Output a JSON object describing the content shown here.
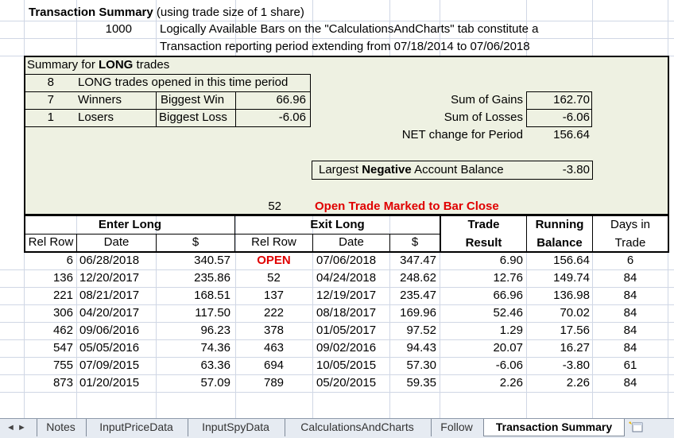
{
  "header": {
    "title_bold": "Transaction Summary",
    "title_rest": " (using trade size of 1 share)",
    "bars_count": "1000",
    "line1": "Logically Available Bars on the \"CalculationsAndCharts\" tab constitute a",
    "line2": "Transaction reporting period extending from 07/18/2014 to 07/06/2018"
  },
  "summary": {
    "heading_prefix": "Summary for ",
    "heading_bold": "LONG",
    "heading_suffix": " trades",
    "trades_opened_count": "8",
    "trades_opened_label": "LONG trades opened in this time period",
    "winners_count": "7",
    "winners_label": "Winners",
    "biggest_win_label": "Biggest Win",
    "biggest_win_value": "66.96",
    "losers_count": "1",
    "losers_label": "Losers",
    "biggest_loss_label": "Biggest Loss",
    "biggest_loss_value": "-6.06",
    "sum_gains_label": "Sum of Gains",
    "sum_gains_value": "162.70",
    "sum_losses_label": "Sum of Losses",
    "sum_losses_value": "-6.06",
    "net_label": "NET change for Period",
    "net_value": "156.64",
    "largest_neg_prefix": "Largest ",
    "largest_neg_bold": "Negative",
    "largest_neg_suffix": " Account Balance",
    "largest_neg_value": "-3.80",
    "open_bar": "52",
    "open_label": "Open Trade Marked to Bar Close"
  },
  "table": {
    "enter_long": "Enter Long",
    "exit_long": "Exit Long",
    "trade_result_1": "Trade",
    "trade_result_2": "Result",
    "running_balance_1": "Running",
    "running_balance_2": "Balance",
    "days_1": "Days in",
    "days_2": "Trade",
    "col_rel_row": "Rel Row",
    "col_date": "Date",
    "col_dollar": "$",
    "col_exit_rel_row": "Rel Row",
    "col_exit_date": "Date",
    "col_exit_dollar": "$",
    "rows": [
      [
        "6",
        "06/28/2018",
        "340.57",
        "OPEN",
        "07/06/2018",
        "347.47",
        "6.90",
        "156.64",
        "6"
      ],
      [
        "136",
        "12/20/2017",
        "235.86",
        "52",
        "04/24/2018",
        "248.62",
        "12.76",
        "149.74",
        "84"
      ],
      [
        "221",
        "08/21/2017",
        "168.51",
        "137",
        "12/19/2017",
        "235.47",
        "66.96",
        "136.98",
        "84"
      ],
      [
        "306",
        "04/20/2017",
        "117.50",
        "222",
        "08/18/2017",
        "169.96",
        "52.46",
        "70.02",
        "84"
      ],
      [
        "462",
        "09/06/2016",
        "96.23",
        "378",
        "01/05/2017",
        "97.52",
        "1.29",
        "17.56",
        "84"
      ],
      [
        "547",
        "05/05/2016",
        "74.36",
        "463",
        "09/02/2016",
        "94.43",
        "20.07",
        "16.27",
        "84"
      ],
      [
        "755",
        "07/09/2015",
        "63.36",
        "694",
        "10/05/2015",
        "57.30",
        "-6.06",
        "-3.80",
        "61"
      ],
      [
        "873",
        "01/20/2015",
        "57.09",
        "789",
        "05/20/2015",
        "59.35",
        "2.26",
        "2.26",
        "84"
      ]
    ]
  },
  "tabs": {
    "nav_prev": "◄",
    "nav_next": "►",
    "items": [
      "Notes",
      "InputPriceData",
      "InputSpyData",
      "CalculationsAndCharts",
      "Follow",
      "Transaction Summary"
    ],
    "active": "Transaction Summary",
    "new_sheet_icon": "new-sheet-icon"
  }
}
